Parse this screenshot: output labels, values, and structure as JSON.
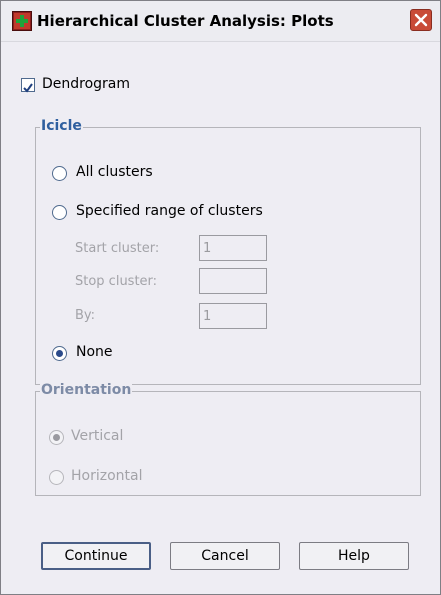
{
  "window": {
    "title": "Hierarchical Cluster Analysis: Plots",
    "icon": "spss-app-icon"
  },
  "dendrogram": {
    "label": "Dendrogram",
    "checked": true
  },
  "icicle": {
    "title": "Icicle",
    "all_clusters": {
      "label": "All clusters",
      "selected": false
    },
    "specified_range": {
      "label": "Specified range of clusters",
      "selected": false
    },
    "start_cluster": {
      "label": "Start cluster:",
      "value": "1"
    },
    "stop_cluster": {
      "label": "Stop cluster:",
      "value": ""
    },
    "by": {
      "label": "By:",
      "value": "1"
    },
    "none": {
      "label": "None",
      "selected": true
    }
  },
  "orientation": {
    "title": "Orientation",
    "vertical": {
      "label": "Vertical",
      "selected": true
    },
    "horizontal": {
      "label": "Horizontal",
      "selected": false
    }
  },
  "buttons": {
    "continue": "Continue",
    "cancel": "Cancel",
    "help": "Help"
  },
  "colors": {
    "group_title": "#2f5f9f",
    "close_button": "#c94b37",
    "dialog_bg": "#eeedf3"
  }
}
